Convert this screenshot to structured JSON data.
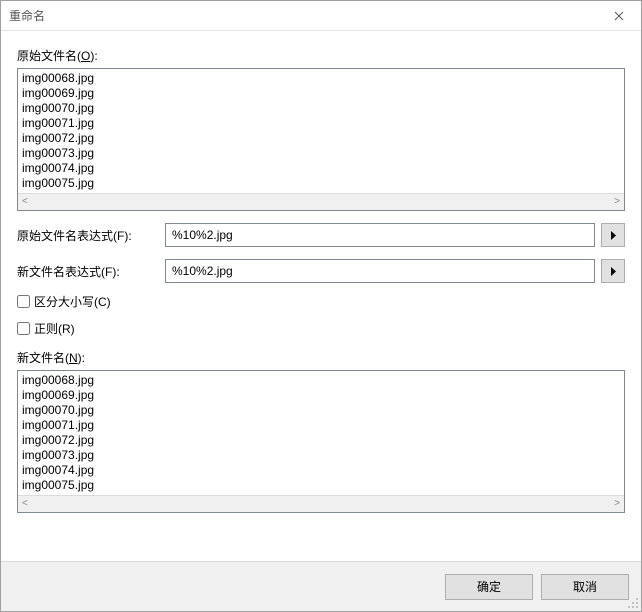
{
  "window": {
    "title": "重命名"
  },
  "labels": {
    "original_filenames": "原始文件名(",
    "original_filenames_accel": "O",
    "label_tail": "):",
    "original_expr": "原始文件名表达式(",
    "original_expr_accel": "F",
    "new_expr": "新文件名表达式(",
    "new_expr_accel": "F",
    "case_sensitive": "区分大小写(",
    "case_sensitive_accel": "C",
    "regex": "正则(",
    "regex_accel": "R",
    "new_filenames": "新文件名(",
    "new_filenames_accel": "N",
    "paren_close": ")"
  },
  "fields": {
    "original_expr_value": "%10%2.jpg",
    "new_expr_value": "%10%2.jpg",
    "case_sensitive_checked": false,
    "regex_checked": false
  },
  "original_files": [
    "img00068.jpg",
    "img00069.jpg",
    "img00070.jpg",
    "img00071.jpg",
    "img00072.jpg",
    "img00073.jpg",
    "img00074.jpg",
    "img00075.jpg"
  ],
  "new_files": [
    "img00068.jpg",
    "img00069.jpg",
    "img00070.jpg",
    "img00071.jpg",
    "img00072.jpg",
    "img00073.jpg",
    "img00074.jpg",
    "img00075.jpg"
  ],
  "buttons": {
    "ok": "确定",
    "cancel": "取消"
  },
  "scroll_arrows": {
    "left": "<",
    "right": ">"
  }
}
